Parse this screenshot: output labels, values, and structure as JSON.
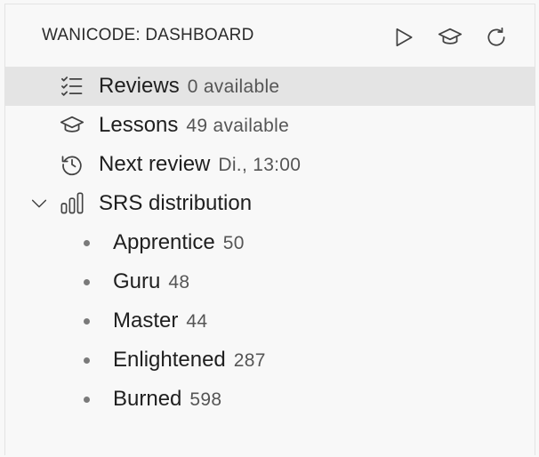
{
  "header": {
    "title": "WANICODE: DASHBOARD",
    "actions": [
      {
        "icon": "play-icon"
      },
      {
        "icon": "mortarboard-icon"
      },
      {
        "icon": "refresh-icon"
      }
    ]
  },
  "tree": {
    "reviews": {
      "label": "Reviews",
      "desc": "0 available",
      "icon": "checklist-icon"
    },
    "lessons": {
      "label": "Lessons",
      "desc": "49 available",
      "icon": "mortarboard-icon"
    },
    "next_review": {
      "label": "Next review",
      "desc": "Di., 13:00",
      "icon": "history-icon"
    },
    "srs": {
      "label": "SRS distribution",
      "icon": "bar-chart-icon",
      "expanded": true,
      "items": [
        {
          "label": "Apprentice",
          "value": "50"
        },
        {
          "label": "Guru",
          "value": "48"
        },
        {
          "label": "Master",
          "value": "44"
        },
        {
          "label": "Enlightened",
          "value": "287"
        },
        {
          "label": "Burned",
          "value": "598"
        }
      ]
    }
  },
  "colors": {
    "selected_bg": "#e4e4e4",
    "panel_bg": "#f8f8f8",
    "icon": "#424242"
  }
}
